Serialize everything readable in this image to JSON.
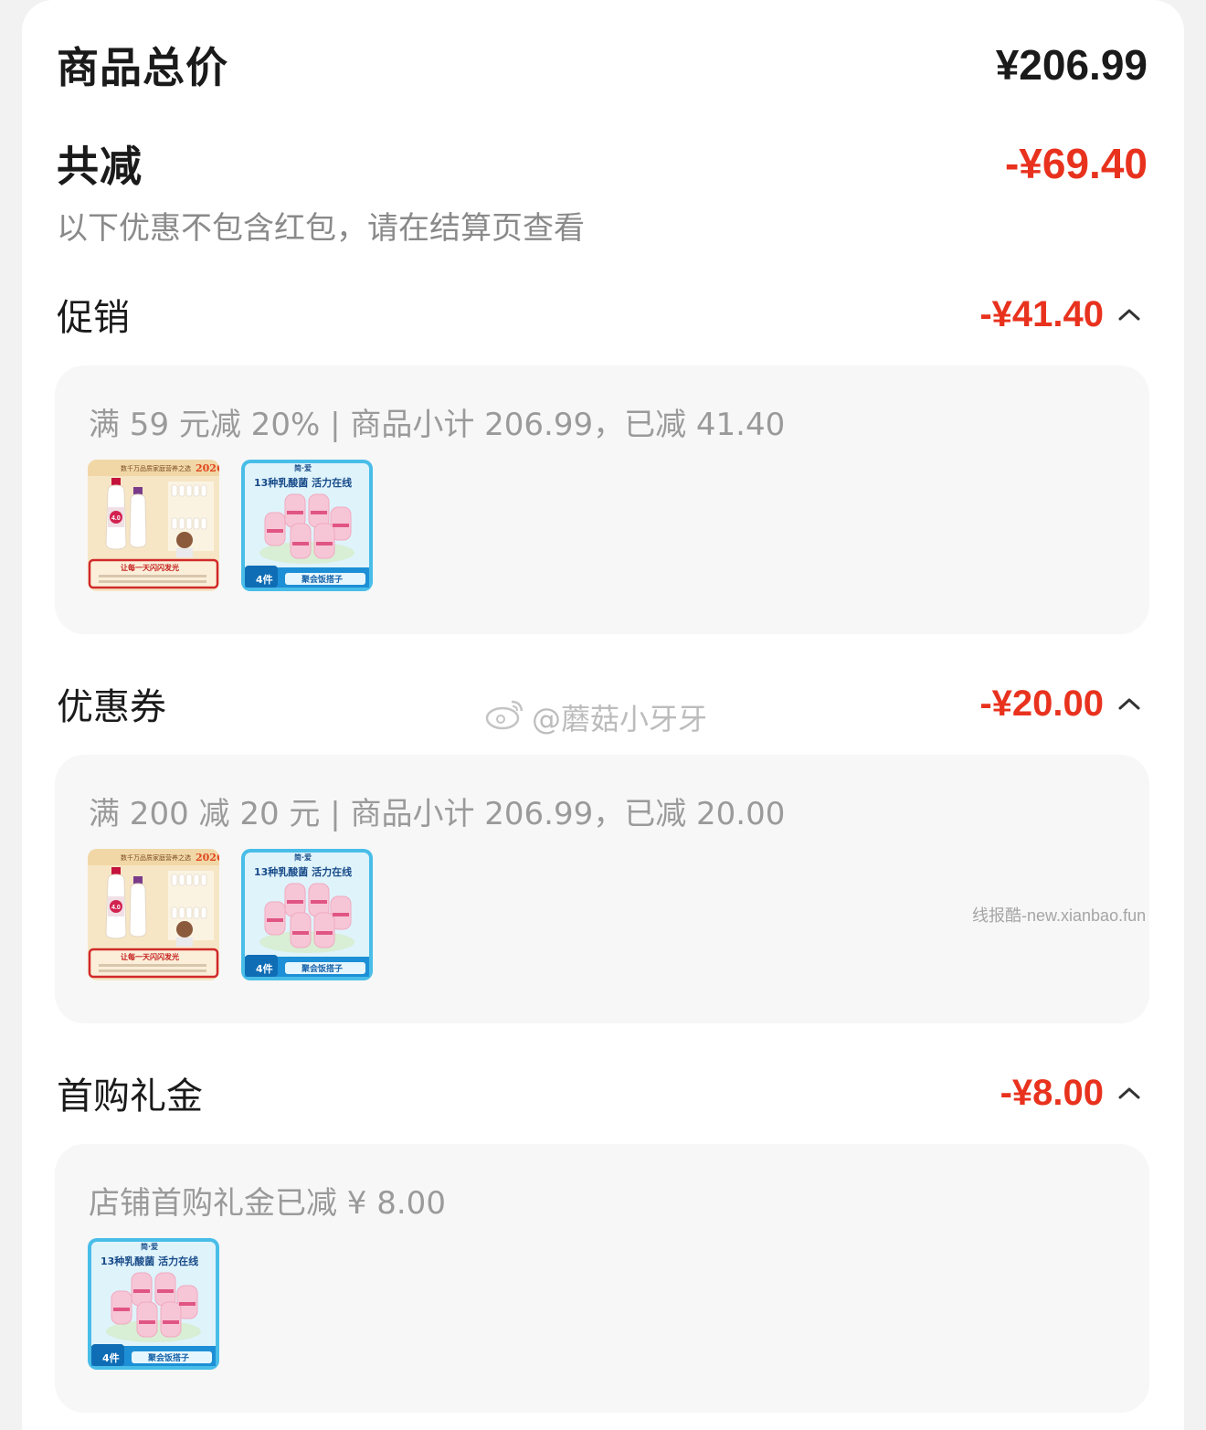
{
  "summary": {
    "total_label": "商品总价",
    "total_value": "¥206.99",
    "reduce_label": "共减",
    "reduce_value": "-¥69.40",
    "note": "以下优惠不包含红包，请在结算页查看"
  },
  "sections": [
    {
      "label": "促销",
      "amount": "-¥41.40",
      "detail": "满 59 元减 20% | 商品小计 206.99，已减 41.40",
      "products": [
        "milk-bottles-thumbnail",
        "lactic-drink-thumbnail"
      ]
    },
    {
      "label": "优惠券",
      "amount": "-¥20.00",
      "detail": "满 200 减 20 元 | 商品小计 206.99，已减 20.00",
      "products": [
        "milk-bottles-thumbnail",
        "lactic-drink-thumbnail"
      ]
    },
    {
      "label": "首购礼金",
      "amount": "-¥8.00",
      "detail": "店铺首购礼金已减 ¥ 8.00",
      "products": [
        "lactic-drink-thumbnail"
      ]
    }
  ],
  "products": {
    "milk": {
      "banner": "数千万品质家庭营养之选",
      "year": "2026",
      "badge": "4.0",
      "caption": "让每一天闪闪发光"
    },
    "lactic": {
      "brand": "简·爱",
      "headline": "13种乳酸菌 活力在线",
      "count": "4件",
      "tag": "聚会饭搭子"
    }
  },
  "watermarks": {
    "weibo": "@蘑菇小牙牙",
    "site": "线报酷-new.xianbao.fun"
  },
  "colors": {
    "accent_red": "#e8321e",
    "panel_bg": "#f7f7f7",
    "text_gray": "#9a9a9a"
  }
}
